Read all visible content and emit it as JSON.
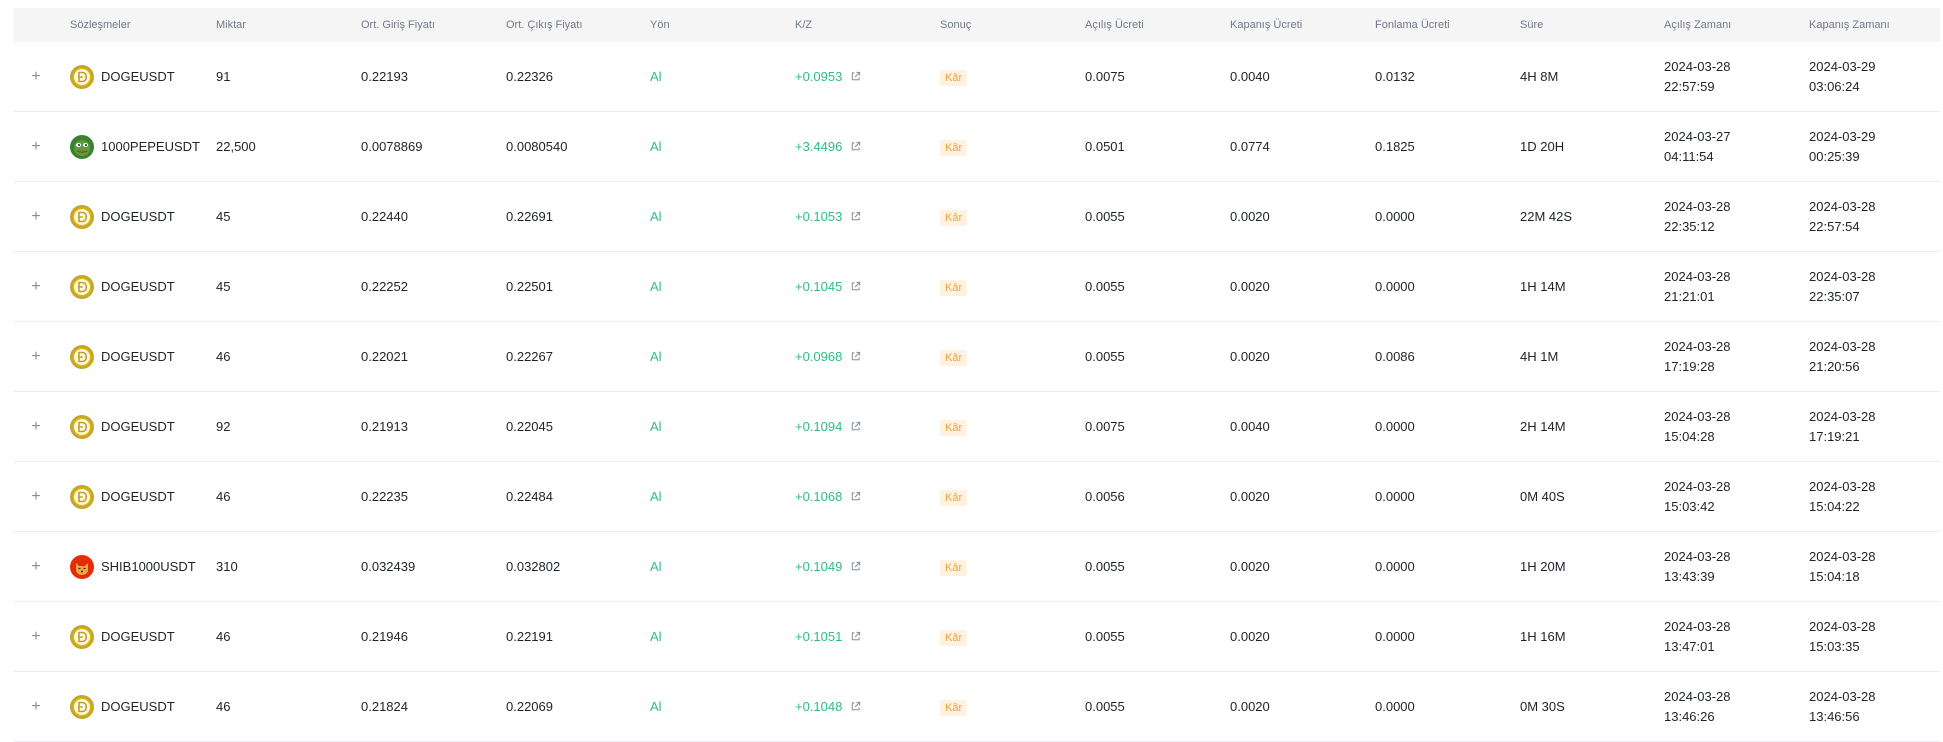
{
  "header": {
    "contracts": "Sözleşmeler",
    "amount": "Miktar",
    "avg_entry": "Ort. Giriş Fiyatı",
    "avg_exit": "Ort. Çıkış Fiyatı",
    "side": "Yön",
    "pnl": "K/Z",
    "result": "Sonuç",
    "open_fee": "Açılış Ücreti",
    "close_fee": "Kapanış Ücreti",
    "funding_fee": "Fonlama Ücreti",
    "duration": "Süre",
    "open_time": "Açılış Zamanı",
    "close_time": "Kapanış Zamanı"
  },
  "expand_symbol": "+",
  "colors": {
    "profit_green": "#2ebd85",
    "badge_bg": "#fff2e0",
    "badge_text": "#f0a33b",
    "header_bg": "#f5f5f5"
  },
  "rows": [
    {
      "symbol": "DOGEUSDT",
      "icon": "doge-coin-icon",
      "amount": "91",
      "entry": "0.22193",
      "exit": "0.22326",
      "side": "Al",
      "pnl": "+0.0953",
      "result": "Kâr",
      "open_fee": "0.0075",
      "close_fee": "0.0040",
      "funding_fee": "0.0132",
      "duration": "4H 8M",
      "open_date": "2024-03-28",
      "open_clock": "22:57:59",
      "close_date": "2024-03-29",
      "close_clock": "03:06:24"
    },
    {
      "symbol": "1000PEPEUSDT",
      "icon": "pepe-coin-icon",
      "amount": "22,500",
      "entry": "0.0078869",
      "exit": "0.0080540",
      "side": "Al",
      "pnl": "+3.4496",
      "result": "Kâr",
      "open_fee": "0.0501",
      "close_fee": "0.0774",
      "funding_fee": "0.1825",
      "duration": "1D 20H",
      "open_date": "2024-03-27",
      "open_clock": "04:11:54",
      "close_date": "2024-03-29",
      "close_clock": "00:25:39"
    },
    {
      "symbol": "DOGEUSDT",
      "icon": "doge-coin-icon",
      "amount": "45",
      "entry": "0.22440",
      "exit": "0.22691",
      "side": "Al",
      "pnl": "+0.1053",
      "result": "Kâr",
      "open_fee": "0.0055",
      "close_fee": "0.0020",
      "funding_fee": "0.0000",
      "duration": "22M 42S",
      "open_date": "2024-03-28",
      "open_clock": "22:35:12",
      "close_date": "2024-03-28",
      "close_clock": "22:57:54"
    },
    {
      "symbol": "DOGEUSDT",
      "icon": "doge-coin-icon",
      "amount": "45",
      "entry": "0.22252",
      "exit": "0.22501",
      "side": "Al",
      "pnl": "+0.1045",
      "result": "Kâr",
      "open_fee": "0.0055",
      "close_fee": "0.0020",
      "funding_fee": "0.0000",
      "duration": "1H 14M",
      "open_date": "2024-03-28",
      "open_clock": "21:21:01",
      "close_date": "2024-03-28",
      "close_clock": "22:35:07"
    },
    {
      "symbol": "DOGEUSDT",
      "icon": "doge-coin-icon",
      "amount": "46",
      "entry": "0.22021",
      "exit": "0.22267",
      "side": "Al",
      "pnl": "+0.0968",
      "result": "Kâr",
      "open_fee": "0.0055",
      "close_fee": "0.0020",
      "funding_fee": "0.0086",
      "duration": "4H 1M",
      "open_date": "2024-03-28",
      "open_clock": "17:19:28",
      "close_date": "2024-03-28",
      "close_clock": "21:20:56"
    },
    {
      "symbol": "DOGEUSDT",
      "icon": "doge-coin-icon",
      "amount": "92",
      "entry": "0.21913",
      "exit": "0.22045",
      "side": "Al",
      "pnl": "+0.1094",
      "result": "Kâr",
      "open_fee": "0.0075",
      "close_fee": "0.0040",
      "funding_fee": "0.0000",
      "duration": "2H 14M",
      "open_date": "2024-03-28",
      "open_clock": "15:04:28",
      "close_date": "2024-03-28",
      "close_clock": "17:19:21"
    },
    {
      "symbol": "DOGEUSDT",
      "icon": "doge-coin-icon",
      "amount": "46",
      "entry": "0.22235",
      "exit": "0.22484",
      "side": "Al",
      "pnl": "+0.1068",
      "result": "Kâr",
      "open_fee": "0.0056",
      "close_fee": "0.0020",
      "funding_fee": "0.0000",
      "duration": "0M 40S",
      "open_date": "2024-03-28",
      "open_clock": "15:03:42",
      "close_date": "2024-03-28",
      "close_clock": "15:04:22"
    },
    {
      "symbol": "SHIB1000USDT",
      "icon": "shib-coin-icon",
      "amount": "310",
      "entry": "0.032439",
      "exit": "0.032802",
      "side": "Al",
      "pnl": "+0.1049",
      "result": "Kâr",
      "open_fee": "0.0055",
      "close_fee": "0.0020",
      "funding_fee": "0.0000",
      "duration": "1H 20M",
      "open_date": "2024-03-28",
      "open_clock": "13:43:39",
      "close_date": "2024-03-28",
      "close_clock": "15:04:18"
    },
    {
      "symbol": "DOGEUSDT",
      "icon": "doge-coin-icon",
      "amount": "46",
      "entry": "0.21946",
      "exit": "0.22191",
      "side": "Al",
      "pnl": "+0.1051",
      "result": "Kâr",
      "open_fee": "0.0055",
      "close_fee": "0.0020",
      "funding_fee": "0.0000",
      "duration": "1H 16M",
      "open_date": "2024-03-28",
      "open_clock": "13:47:01",
      "close_date": "2024-03-28",
      "close_clock": "15:03:35"
    },
    {
      "symbol": "DOGEUSDT",
      "icon": "doge-coin-icon",
      "amount": "46",
      "entry": "0.21824",
      "exit": "0.22069",
      "side": "Al",
      "pnl": "+0.1048",
      "result": "Kâr",
      "open_fee": "0.0055",
      "close_fee": "0.0020",
      "funding_fee": "0.0000",
      "duration": "0M 30S",
      "open_date": "2024-03-28",
      "open_clock": "13:46:26",
      "close_date": "2024-03-28",
      "close_clock": "13:46:56"
    }
  ]
}
